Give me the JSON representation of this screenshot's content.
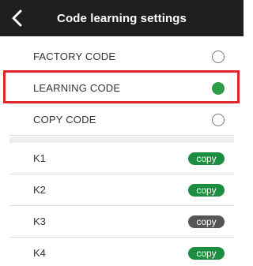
{
  "header": {
    "title": "Code learning settings"
  },
  "modes": [
    {
      "label": "FACTORY CODE",
      "selected": false
    },
    {
      "label": "LEARNING CODE",
      "selected": true
    },
    {
      "label": "COPY CODE",
      "selected": false
    }
  ],
  "keys": [
    {
      "label": "K1",
      "button": "copy",
      "enabled": true
    },
    {
      "label": "K2",
      "button": "copy",
      "enabled": true
    },
    {
      "label": "K3",
      "button": "copy",
      "enabled": false
    },
    {
      "label": "K4",
      "button": "copy",
      "enabled": true
    }
  ],
  "colors": {
    "header_bg": "#1f1f1f",
    "selected_radio": "#2f9a48",
    "copy_enabled": "#1c8f3e",
    "copy_disabled": "#555555",
    "highlight": "#e0262b"
  },
  "icons": {
    "back": "chevron-left-icon"
  }
}
